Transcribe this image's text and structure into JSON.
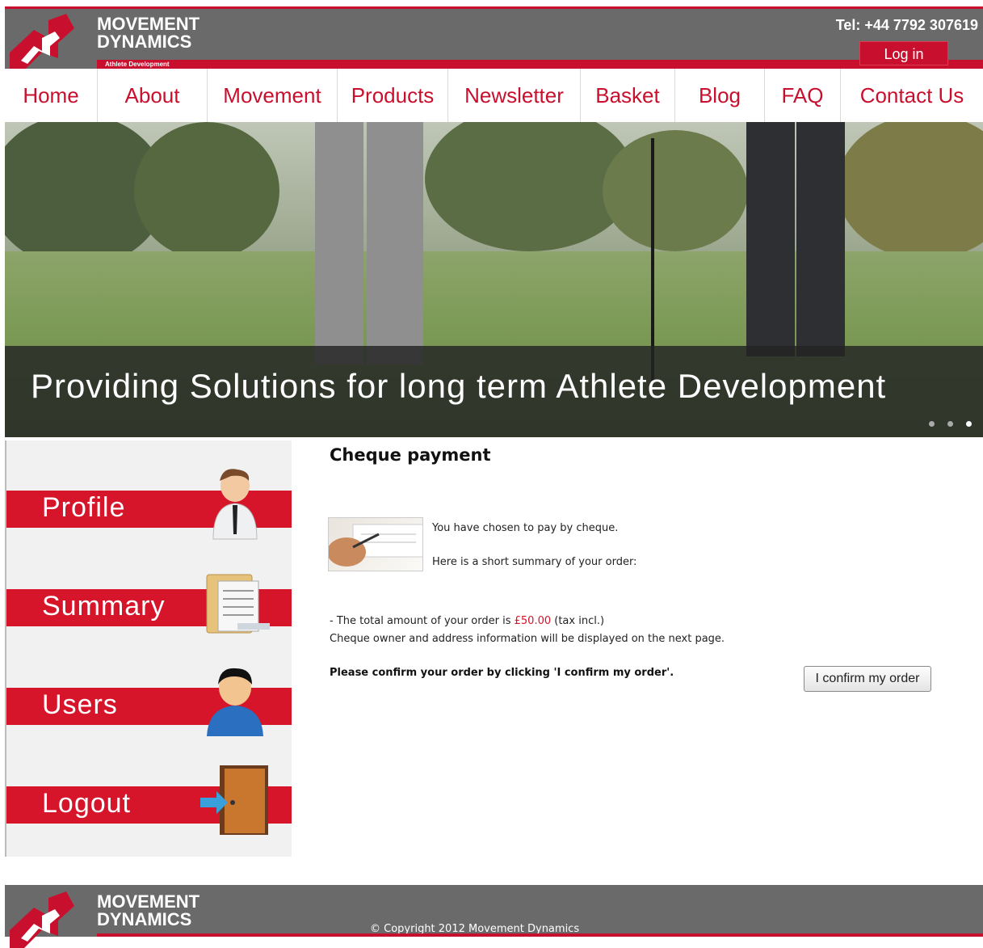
{
  "header": {
    "brand_line1": "MOVEMENT",
    "brand_line2": "DYNAMICS",
    "brand_sub": "Athlete Development",
    "tel": "Tel: +44 7792 307619",
    "login_label": "Log in"
  },
  "nav": {
    "items": [
      "Home",
      "About",
      "Movement",
      "Products",
      "Newsletter",
      "Basket",
      "Blog",
      "FAQ",
      "Contact Us"
    ]
  },
  "hero": {
    "caption": "Providing Solutions for long term Athlete Development",
    "active_slide": 3,
    "slide_count": 3
  },
  "sidebar": {
    "items": [
      "Profile",
      "Summary",
      "Users",
      "Logout"
    ]
  },
  "main": {
    "title": "Cheque payment",
    "msg_line1": "You have chosen to pay by cheque.",
    "msg_line2": "Here is a short summary of your order:",
    "amount_prefix": "- The total amount of your order is ",
    "amount": "£50.00",
    "amount_suffix": " (tax incl.)",
    "info": "Cheque owner and address information will be displayed on the next page.",
    "confirm_text": "Please confirm your order by clicking 'I confirm my order'.",
    "confirm_button": "I confirm my order"
  },
  "footer": {
    "brand_line1": "MOVEMENT",
    "brand_line2": "DYNAMICS",
    "copyright": "© Copyright 2012 Movement Dynamics"
  },
  "colors": {
    "accent": "#c8102e",
    "header_bg": "#6a6a6a",
    "sidebar_bg": "#f1f1f1"
  }
}
